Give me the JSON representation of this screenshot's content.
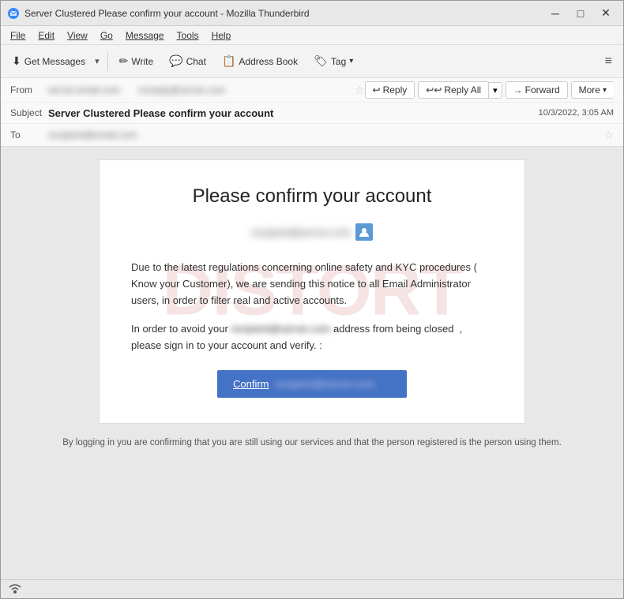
{
  "window": {
    "title": "Server Clustered Please confirm your account - Mozilla Thunderbird",
    "controls": {
      "minimize": "─",
      "maximize": "□",
      "close": "✕"
    }
  },
  "menubar": {
    "items": [
      "File",
      "Edit",
      "View",
      "Go",
      "Message",
      "Tools",
      "Help"
    ]
  },
  "toolbar": {
    "get_messages_label": "Get Messages",
    "write_label": "Write",
    "chat_label": "Chat",
    "address_book_label": "Address Book",
    "tag_label": "Tag"
  },
  "email_header": {
    "from_label": "From",
    "from_value": "server.email.com  noreply@server.com",
    "subject_label": "Subject",
    "subject_text": "Server Clustered Please confirm your account",
    "date_text": "10/3/2022, 3:05 AM",
    "to_label": "To",
    "to_value": "recipient@email.com",
    "reply_label": "Reply",
    "reply_all_label": "Reply All",
    "forward_label": "Forward",
    "more_label": "More"
  },
  "email_body": {
    "title": "Please confirm your account",
    "recipient_address": "recipient@server.com",
    "paragraph1": "Due to the latest regulations concerning online safety and KYC procedures ( Know your Customer), we are sending this notice to all Email Administrator users, in order to filter real and active accounts.",
    "paragraph2_before": "In order to avoid your",
    "paragraph2_blurred": "recipient@server.com",
    "paragraph2_after": "address from being closed  ,\nplease sign in to your account and verify. :",
    "confirm_label": "Confirm",
    "confirm_blurred": "recipient@server.com",
    "footer_text": "By logging in you are confirming that you are still using our services and that the person registered is the\nperson using them.",
    "watermark": "DISTORT"
  },
  "statusbar": {
    "wifi_icon": "wifi"
  }
}
